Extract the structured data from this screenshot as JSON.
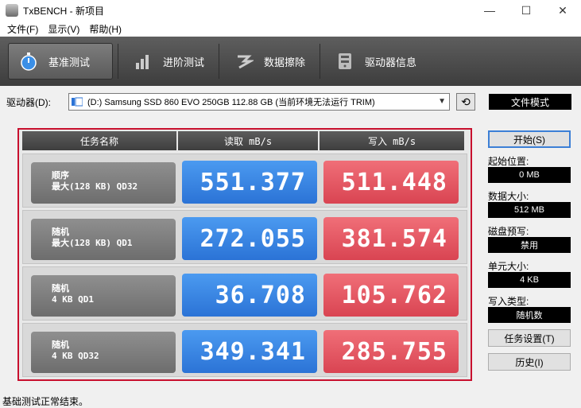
{
  "window": {
    "title": "TxBENCH - 新项目",
    "minimize": "—",
    "maximize": "☐",
    "close": "✕"
  },
  "menu": [
    "文件(F)",
    "显示(V)",
    "帮助(H)"
  ],
  "tabs": [
    {
      "label": "基准测试",
      "icon": "stopwatch-icon",
      "active": true
    },
    {
      "label": "进阶测试",
      "icon": "bar-chart-icon",
      "active": false
    },
    {
      "label": "数据擦除",
      "icon": "eraser-icon",
      "active": false
    },
    {
      "label": "驱动器信息",
      "icon": "drive-info-icon",
      "active": false
    }
  ],
  "drive": {
    "label": "驱动器(D):",
    "selected": "(D:) Samsung SSD 860 EVO 250GB  112.88 GB (当前环境无法运行 TRIM)",
    "mode": "文件模式"
  },
  "table": {
    "headers": [
      "任务名称",
      "读取 mB/s",
      "写入 mB/s"
    ],
    "rows": [
      {
        "line1": "顺序",
        "line2": "最大(128 KB) QD32",
        "read": "551.377",
        "write": "511.448"
      },
      {
        "line1": "随机",
        "line2": "最大(128 KB) QD1",
        "read": "272.055",
        "write": "381.574"
      },
      {
        "line1": "随机",
        "line2": "4 KB QD1",
        "read": "36.708",
        "write": "105.762"
      },
      {
        "line1": "随机",
        "line2": "4 KB QD32",
        "read": "349.341",
        "write": "285.755"
      }
    ]
  },
  "side": {
    "start": "开始(S)",
    "start_pos_label": "起始位置:",
    "start_pos_value": "0 MB",
    "data_size_label": "数据大小:",
    "data_size_value": "512 MB",
    "precond_label": "磁盘预写:",
    "precond_value": "禁用",
    "unit_size_label": "单元大小:",
    "unit_size_value": "4 KB",
    "write_type_label": "写入类型:",
    "write_type_value": "随机数",
    "task_settings": "任务设置(T)",
    "history": "历史(I)"
  },
  "status": "基础测试正常结束。",
  "colors": {
    "read": "#2b73d6",
    "write": "#d94452",
    "highlight": "#c8102e"
  }
}
